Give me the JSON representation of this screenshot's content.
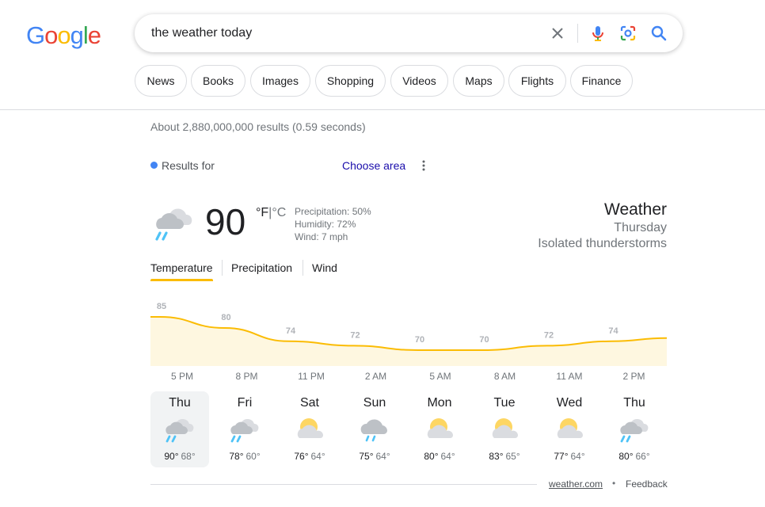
{
  "logo": {
    "letters": [
      "G",
      "o",
      "o",
      "g",
      "l",
      "e"
    ],
    "colors": [
      "#4285f4",
      "#ea4335",
      "#fbbc05",
      "#4285f4",
      "#34a853",
      "#ea4335"
    ]
  },
  "search": {
    "query": "the weather today"
  },
  "chips": [
    "News",
    "Books",
    "Images",
    "Shopping",
    "Videos",
    "Maps",
    "Flights",
    "Finance"
  ],
  "result_stats": "About 2,880,000,000 results (0.59 seconds)",
  "location": {
    "results_for": "Results for",
    "choose_area": "Choose area"
  },
  "current": {
    "icon": "rain-cloud-icon",
    "temperature": "90",
    "unit_f": "°F",
    "unit_sep": "|",
    "unit_c": "°C",
    "precipitation": "Precipitation: 50%",
    "humidity": "Humidity: 72%",
    "wind": "Wind: 7 mph",
    "title": "Weather",
    "day": "Thursday",
    "condition": "Isolated thunderstorms"
  },
  "tabs": [
    "Temperature",
    "Precipitation",
    "Wind"
  ],
  "chart_data": {
    "type": "area",
    "unit": "°F",
    "times": [
      "5 PM",
      "8 PM",
      "11 PM",
      "2 AM",
      "5 AM",
      "8 AM",
      "11 AM",
      "2 PM"
    ],
    "labels": [
      85,
      80,
      74,
      72,
      70,
      70,
      72,
      74
    ],
    "ylim": [
      60,
      90
    ],
    "accent": "#fbbc04",
    "fill": "#fef7e0"
  },
  "forecast": [
    {
      "day": "Thu",
      "icon": "rain-cloud-icon",
      "high": "90°",
      "low": "68°"
    },
    {
      "day": "Fri",
      "icon": "rain-cloud-icon",
      "high": "78°",
      "low": "60°"
    },
    {
      "day": "Sat",
      "icon": "partly-cloudy-icon",
      "high": "76°",
      "low": "64°"
    },
    {
      "day": "Sun",
      "icon": "showers-icon",
      "high": "75°",
      "low": "64°"
    },
    {
      "day": "Mon",
      "icon": "partly-cloudy-icon",
      "high": "80°",
      "low": "64°"
    },
    {
      "day": "Tue",
      "icon": "partly-cloudy-icon",
      "high": "83°",
      "low": "65°"
    },
    {
      "day": "Wed",
      "icon": "partly-cloudy-icon",
      "high": "77°",
      "low": "64°"
    },
    {
      "day": "Thu",
      "icon": "rain-cloud-icon",
      "high": "80°",
      "low": "66°"
    }
  ],
  "footer": {
    "source": "weather.com",
    "dot": "•",
    "feedback": "Feedback"
  }
}
